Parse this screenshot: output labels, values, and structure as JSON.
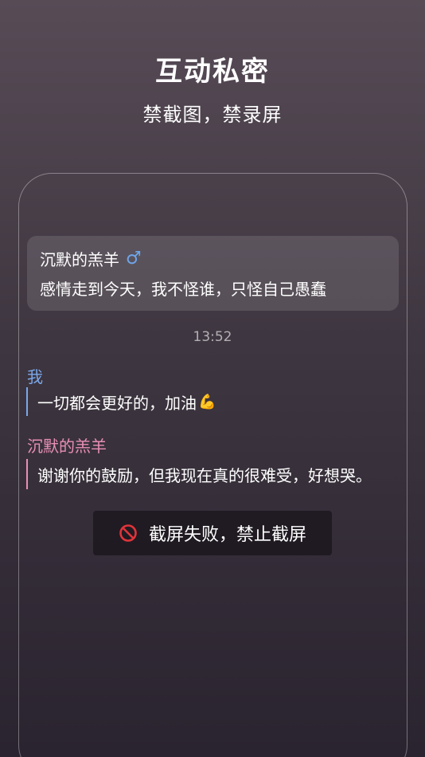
{
  "header": {
    "title": "互动私密",
    "subtitle": "禁截图，禁录屏"
  },
  "notification": {
    "name": "沉默的羔羊",
    "gender_icon": "♂",
    "message": "感情走到今天，我不怪谁，只怪自己愚蠢"
  },
  "chat": {
    "timestamp": "13:52",
    "messages": [
      {
        "sender": "我",
        "text": "一切都会更好的，加油",
        "emoji": "💪"
      },
      {
        "sender": "沉默的羔羊",
        "text": "谢谢你的鼓励，但我现在真的很难受，好想哭。"
      }
    ]
  },
  "toast": {
    "icon": "prohibited-icon",
    "text": "截屏失败，禁止截屏"
  },
  "colors": {
    "me": "#7aa7ea",
    "other": "#e98fb5",
    "prohibited": "#e0343a"
  }
}
